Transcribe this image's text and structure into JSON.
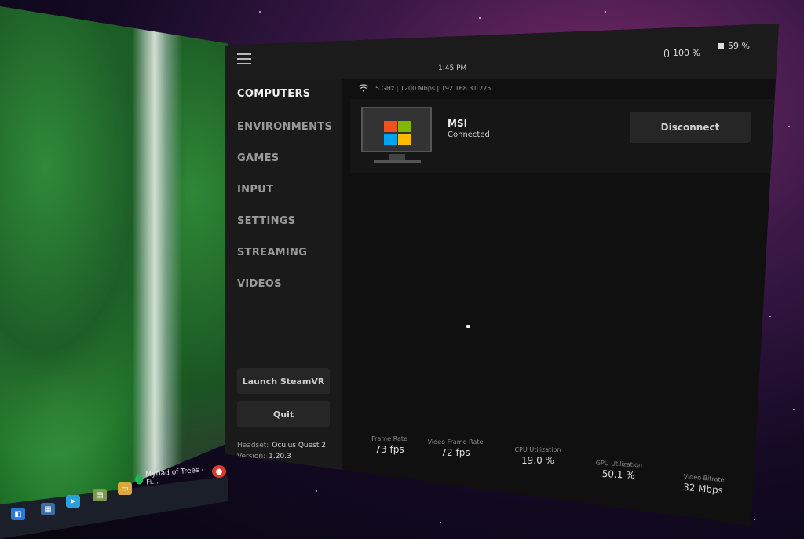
{
  "desktop": {
    "taskbar_app_label": "Myriad of Trees - Fi..."
  },
  "topbar": {
    "time": "1:45 PM",
    "controller_battery": "100 %",
    "headset_battery": "59 %"
  },
  "sidebar": {
    "items": [
      {
        "label": "COMPUTERS",
        "active": true
      },
      {
        "label": "ENVIRONMENTS",
        "active": false
      },
      {
        "label": "GAMES",
        "active": false
      },
      {
        "label": "INPUT",
        "active": false
      },
      {
        "label": "SETTINGS",
        "active": false
      },
      {
        "label": "STREAMING",
        "active": false
      },
      {
        "label": "VIDEOS",
        "active": false
      }
    ],
    "launch_label": "Launch SteamVR",
    "quit_label": "Quit",
    "headset_label": "Headset:",
    "headset_value": "Oculus Quest 2",
    "version_label": "Version:",
    "version_value": "1.20.3"
  },
  "network": {
    "info": "5 GHz | 1200 Mbps | 192.168.31.225"
  },
  "computer": {
    "name": "MSI",
    "status": "Connected",
    "disconnect_label": "Disconnect"
  },
  "metrics": [
    {
      "label": "Frame Rate",
      "value": "73 fps"
    },
    {
      "label": "Video Frame Rate",
      "value": "72 fps"
    },
    {
      "label": "CPU Utilization",
      "value": "19.0 %"
    },
    {
      "label": "GPU Utilization",
      "value": "50.1 %"
    },
    {
      "label": "Video Bitrate",
      "value": "32 Mbps"
    }
  ],
  "colors": {
    "win_red": "#f25022",
    "win_green": "#7fba00",
    "win_blue": "#00a4ef",
    "win_yellow": "#ffb900"
  }
}
